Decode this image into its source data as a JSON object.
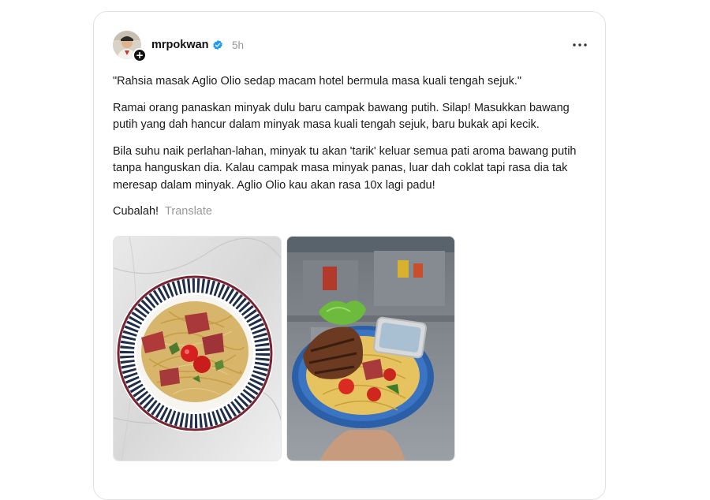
{
  "post": {
    "username": "mrpokwan",
    "timestamp": "5h",
    "follow_symbol": "+",
    "paragraphs": [
      "\"Rahsia masak Aglio Olio sedap macam hotel bermula masa kuali tengah sejuk.\"",
      "Ramai orang panaskan minyak dulu baru campak bawang putih. Silap! Masukkan bawang putih yang dah hancur dalam minyak masa kuali tengah sejuk, baru bukak api kecik.",
      "Bila suhu naik perlahan-lahan, minyak tu akan 'tarik' keluar semua pati aroma bawang putih tanpa hanguskan dia. Kalau campak masa minyak panas, luar dah coklat tapi rasa dia tak meresap dalam minyak. Aglio Olio kau akan rasa 10x lagi padu!"
    ],
    "cta": "Cubalah!",
    "translate_label": "Translate",
    "icons": {
      "verified": "verified-badge-icon",
      "more": "more-options-icon"
    },
    "colors": {
      "verified": "#1d9bf0",
      "muted": "#999999",
      "border": "#e2e2e2"
    }
  }
}
